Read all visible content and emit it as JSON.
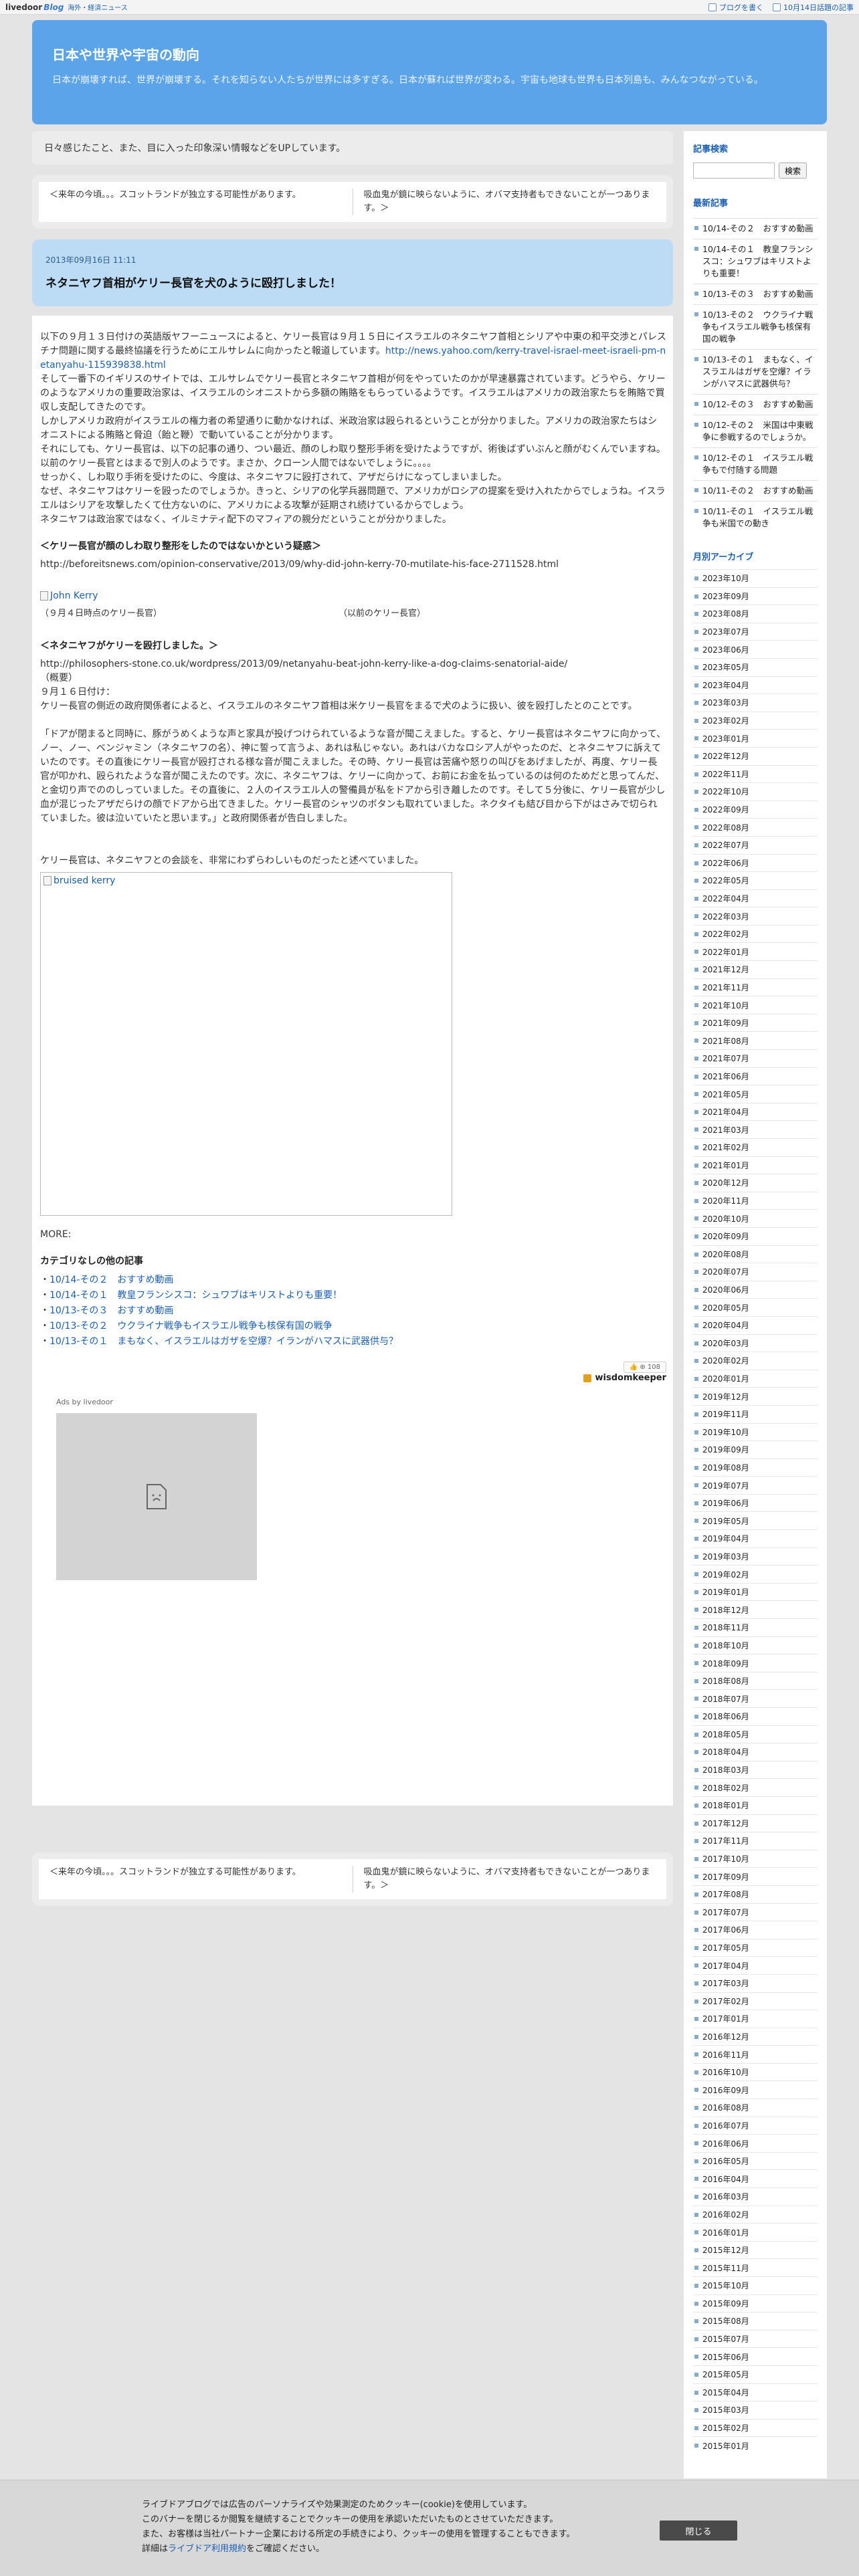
{
  "topbar": {
    "logo": "livedoor",
    "logo_blog": "Blog",
    "news_link": "海外・経済ニュース",
    "write_blog": "ブログを書く",
    "trending": "10月14日話題の記事"
  },
  "header": {
    "title": "日本や世界や宇宙の動向",
    "description": "日本が崩壊すれば、世界が崩壊する。それを知らない人たちが世界には多すぎる。日本が蘇れば世界が変わる。宇宙も地球も世界も日本列島も、みんなつながっている。"
  },
  "intro": "日々感じたこと、また、目に入った印象深い情報などをUPしています。",
  "pager": {
    "prev": "＜来年の今頃。。。スコットランドが独立する可能性があります。",
    "next": "吸血鬼が鏡に映らないように、オバマ支持者もできないことが一つあります。＞"
  },
  "post": {
    "date": "2013年09月16日 11:11",
    "title": "ネタニヤフ首相がケリー長官を犬のように殴打しました！",
    "para1": "以下の９月１３日付けの英語版ヤフーニュースによると、ケリー長官は９月１５日にイスラエルのネタニヤフ首相とシリアや中東の和平交渉とパレスチナ問題に関する最終協議を行うためにエルサレムに向かったと報道しています。",
    "link1": "http://news.yahoo.com/kerry-travel-israel-meet-israeli-pm-netanyahu-115939838.html",
    "para2": "そして一番下のイギリスのサイトでは、エルサレムでケリー長官とネタニヤフ首相が何をやっていたのかが早速暴露されています。どうやら、ケリーのようなアメリカの重要政治家は、イスラエルのシオニストから多額の賄賂をもらっているようです。イスラエルはアメリカの政治家たちを賄賂で買収し支配してきたのです。",
    "para3": "しかしアメリカ政府がイスラエルの権力者の希望通りに動かなければ、米政治家は殴られるということが分かりました。アメリカの政治家たちはシオニストによる賄賂と脅迫（飴と鞭）で動いていることが分かります。",
    "para4": "それにしても、ケリー長官は、以下の記事の通り、つい最近、顔のしわ取り整形手術を受けたようですが、術後ばずいぶんと顔がむくんでいますね。以前のケリー長官とはまるで別人のようです。まさか、クローン人間ではないでしょうに。。。。",
    "para5": "せっかく、しわ取り手術を受けたのに、今度は、ネタニヤフに殴打されて、アザだらけになってしまいました。",
    "para6": "なぜ、ネタニヤフはケリーを殴ったのでしょうか。きっと、シリアの化学兵器問題で、アメリカがロシアの提案を受け入れたからでしょうね。イスラエルはシリアを攻撃したくて仕方ないのに、アメリカによる攻撃が延期され続けているからでしょう。",
    "para7": "ネタニヤフは政治家ではなく、イルミナティ配下のマフィアの親分だということが分かりました。",
    "heading1": "＜ケリー長官が顔のしわ取り整形をしたのではないかという疑惑＞",
    "link2": "http://beforeitsnews.com/opinion-conservative/2013/09/why-did-john-kerry-70-mutilate-his-face-2711528.html",
    "img1_alt": "John Kerry",
    "caption_left": "（９月４日時点のケリー長官）",
    "caption_right": "（以前のケリー長官）",
    "heading2": "＜ネタニヤフがケリーを殴打しました。＞",
    "src3": "http://philosophers-stone.co.uk/wordpress/2013/09/netanyahu-beat-john-kerry-like-a-dog-claims-senatorial-aide/",
    "summary_label": "（概要）",
    "summary_date": "９月１６日付け：",
    "summary1": "ケリー長官の側近の政府関係者によると、イスラエルのネタニヤフ首相は米ケリー長官をまるで犬のように扱い、彼を殴打したとのことです。",
    "quote": "「ドアが閉まると同時に、豚がうめくような声と家具が投げつけられているような音が聞こえました。すると、ケリー長官はネタニヤフに向かって、ノー、ノー、ベンジャミン（ネタニヤフの名）、神に誓って言うよ、あれは私じゃない。あれはバカなロシア人がやったのだ、とネタニヤフに訴えていたのです。その直後にケリー長官が殴打される様な音が聞こえました。その時、ケリー長官は苦痛や怒りの叫びをあげましたが、再度、ケリー長官が叩かれ、殴られたような音が聞こえたのです。次に、ネタニヤフは、ケリーに向かって、お前にお金を払っているのは何のためだと思ってんだ、と金切り声でののしっていました。その直後に、２人のイスラエル人の警備員が私をドアから引き離したのです。そして５分後に、ケリー長官が少し血が混じったアザだらけの顔でドアから出てきました。ケリー長官のシャツのボタンも取れていました。ネクタイも結び目から下がはさみで切られていました。彼は泣いていたと思います。」と政府関係者が告白しました。",
    "after_quote": "ケリー長官は、ネタニヤフとの会談を、非常にわずらわしいものだったと述べていました。",
    "img2_alt": "bruised kerry",
    "more": "MORE:",
    "category_heading": "カテゴリなしの他の記事",
    "related": [
      "10/14-その２　おすすめ動画",
      "10/14-その１　教皇フランシスコ：シュワブはキリストよりも重要！",
      "10/13-その３　おすすめ動画",
      "10/13-その２　ウクライナ戦争もイスラエル戦争も核保有国の戦争",
      "10/13-その１　まもなく、イスラエルはガザを空爆？イランがハマスに武器供与？"
    ],
    "like_count": "108",
    "author": "wisdomkeeper",
    "ad_label": "Ads by livedoor"
  },
  "sidebar": {
    "search_heading": "記事検索",
    "search_button": "検索",
    "search_placeholder": "",
    "recent_heading": "最新記事",
    "recent": [
      "10/14-その２　おすすめ動画",
      "10/14-その１　教皇フランシスコ：シュワブはキリストよりも重要！",
      "10/13-その３　おすすめ動画",
      "10/13-その２　ウクライナ戦争もイスラエル戦争も核保有国の戦争",
      "10/13-その１　まもなく、イスラエルはガザを空爆？イランがハマスに武器供与？",
      "10/12-その３　おすすめ動画",
      "10/12-その２　米国は中東戦争に参戦するのでしょうか。",
      "10/12-その１　イスラエル戦争もで付随する問題",
      "10/11-その２　おすすめ動画",
      "10/11-その１　イスラエル戦争も米国での動き"
    ],
    "archive_heading": "月別アーカイブ",
    "archive": [
      "2023年10月",
      "2023年09月",
      "2023年08月",
      "2023年07月",
      "2023年06月",
      "2023年05月",
      "2023年04月",
      "2023年03月",
      "2023年02月",
      "2023年01月",
      "2022年12月",
      "2022年11月",
      "2022年10月",
      "2022年09月",
      "2022年08月",
      "2022年07月",
      "2022年06月",
      "2022年05月",
      "2022年04月",
      "2022年03月",
      "2022年02月",
      "2022年01月",
      "2021年12月",
      "2021年11月",
      "2021年10月",
      "2021年09月",
      "2021年08月",
      "2021年07月",
      "2021年06月",
      "2021年05月",
      "2021年04月",
      "2021年03月",
      "2021年02月",
      "2021年01月",
      "2020年12月",
      "2020年11月",
      "2020年10月",
      "2020年09月",
      "2020年08月",
      "2020年07月",
      "2020年06月",
      "2020年05月",
      "2020年04月",
      "2020年03月",
      "2020年02月",
      "2020年01月",
      "2019年12月",
      "2019年11月",
      "2019年10月",
      "2019年09月",
      "2019年08月",
      "2019年07月",
      "2019年06月",
      "2019年05月",
      "2019年04月",
      "2019年03月",
      "2019年02月",
      "2019年01月",
      "2018年12月",
      "2018年11月",
      "2018年10月",
      "2018年09月",
      "2018年08月",
      "2018年07月",
      "2018年06月",
      "2018年05月",
      "2018年04月",
      "2018年03月",
      "2018年02月",
      "2018年01月",
      "2017年12月",
      "2017年11月",
      "2017年10月",
      "2017年09月",
      "2017年08月",
      "2017年07月",
      "2017年06月",
      "2017年05月",
      "2017年04月",
      "2017年03月",
      "2017年02月",
      "2017年01月",
      "2016年12月",
      "2016年11月",
      "2016年10月",
      "2016年09月",
      "2016年08月",
      "2016年07月",
      "2016年06月",
      "2016年05月",
      "2016年04月",
      "2016年03月",
      "2016年02月",
      "2016年01月",
      "2015年12月",
      "2015年11月",
      "2015年10月",
      "2015年09月",
      "2015年08月",
      "2015年07月",
      "2015年06月",
      "2015年05月",
      "2015年04月",
      "2015年03月",
      "2015年02月",
      "2015年01月"
    ]
  },
  "cookie": {
    "line1": "ライブドアブログでは広告のパーソナライズや効果測定のためクッキー(cookie)を使用しています。",
    "line2": "このバナーを閉じるか閲覧を継続することでクッキーの使用を承認いただいたものとさせていただきます。",
    "line3": "また、お客様は当社パートナー企業における所定の手続きにより、クッキーの使用を管理することもできます。",
    "line4_pre": "詳細は",
    "line4_link": "ライブドア利用規約",
    "line4_post": "をご確認ください。",
    "close": "閉じる"
  }
}
